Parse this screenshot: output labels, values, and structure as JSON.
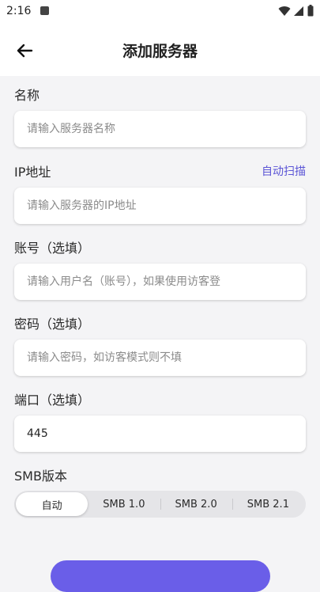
{
  "status_bar": {
    "time": "2:16"
  },
  "app_bar": {
    "title": "添加服务器"
  },
  "form": {
    "name": {
      "label": "名称",
      "placeholder": "请输入服务器名称",
      "value": ""
    },
    "ip": {
      "label": "IP地址",
      "auto_scan": "自动扫描",
      "placeholder": "请输入服务器的IP地址",
      "value": ""
    },
    "account": {
      "label": "账号（选填）",
      "placeholder": "请输入用户名（账号），如果使用访客登",
      "value": ""
    },
    "password": {
      "label": "密码（选填）",
      "placeholder": "请输入密码，如访客模式则不填",
      "value": ""
    },
    "port": {
      "label": "端口（选填）",
      "placeholder": "",
      "value": "445"
    },
    "smb": {
      "label": "SMB版本",
      "options": [
        "自动",
        "SMB 1.0",
        "SMB 2.0",
        "SMB 2.1"
      ],
      "selected": "自动"
    }
  },
  "colors": {
    "accent": "#6a5ee8",
    "link": "#5b55d6",
    "background": "#f4f4f6"
  }
}
